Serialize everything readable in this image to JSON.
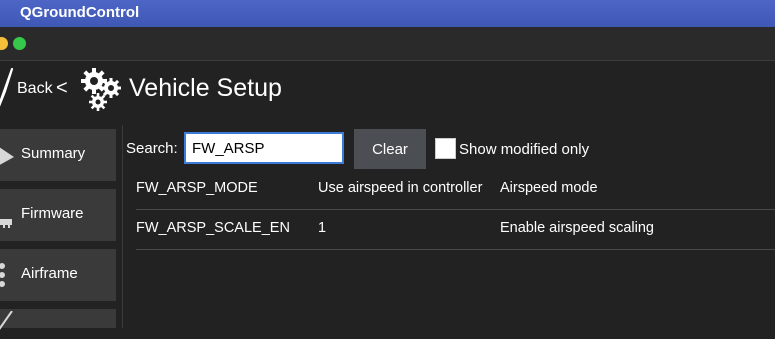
{
  "app": {
    "title": "QGroundControl"
  },
  "header": {
    "back_label": "Back",
    "back_chevron": "<",
    "page_title": "Vehicle Setup",
    "icons": [
      "plane-icon",
      "gears-icon"
    ]
  },
  "sidebar": {
    "items": [
      {
        "label": "Summary",
        "icon": "plane-icon"
      },
      {
        "label": "Firmware",
        "icon": "firmware-icon"
      },
      {
        "label": "Airframe",
        "icon": "airframe-icon"
      },
      {
        "label": "",
        "icon": "plane-icon"
      }
    ]
  },
  "search": {
    "label": "Search:",
    "value": "FW_ARSP",
    "clear_label": "Clear",
    "modified_only_label": "Show modified only",
    "modified_only_checked": false
  },
  "params": {
    "rows": [
      {
        "name": "FW_ARSP_MODE",
        "value": "Use airspeed in controller",
        "description": "Airspeed mode"
      },
      {
        "name": "FW_ARSP_SCALE_EN",
        "value": "1",
        "description": "Enable airspeed scaling"
      }
    ]
  },
  "colors": {
    "titlebar": "#4d66c6",
    "background": "#222222",
    "panel": "#3a3a3a",
    "button": "#4b4e52",
    "focus": "#3d7bd9",
    "traffic_yellow": "#f5bf3a",
    "traffic_green": "#35c84a"
  }
}
